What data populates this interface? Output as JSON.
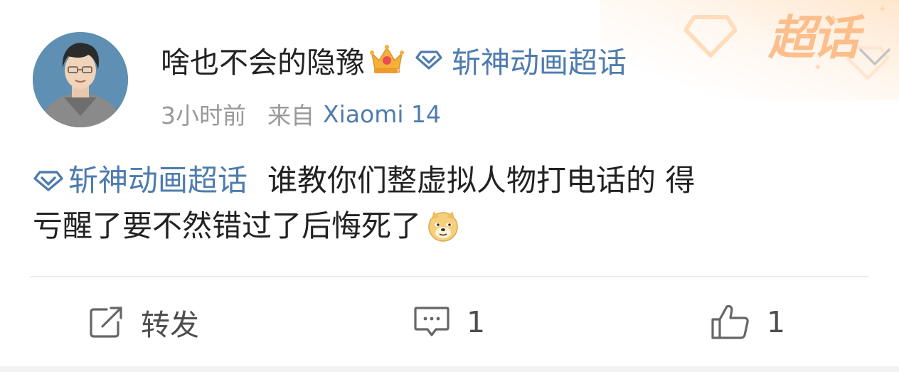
{
  "post": {
    "username": "啥也不会的隐豫",
    "badge": "crown-icon",
    "topic_chip": "斩神动画超话",
    "time": "3小时前",
    "source_label": "来自",
    "source_device": "Xiaomi 14",
    "body_topic": "斩神动画超话",
    "body_line1": "谁教你们整虚拟人物打电话的 得",
    "body_line2": "亏醒了要不然错过了后悔死了",
    "emoji": "doge-icon"
  },
  "decor": {
    "watermark": "超话"
  },
  "actions": {
    "repost_label": "转发",
    "comment_count": "1",
    "like_count": "1"
  },
  "colors": {
    "link": "#4f7cae",
    "text": "#222222",
    "meta": "#999999",
    "watermark": "#fbb67d"
  }
}
